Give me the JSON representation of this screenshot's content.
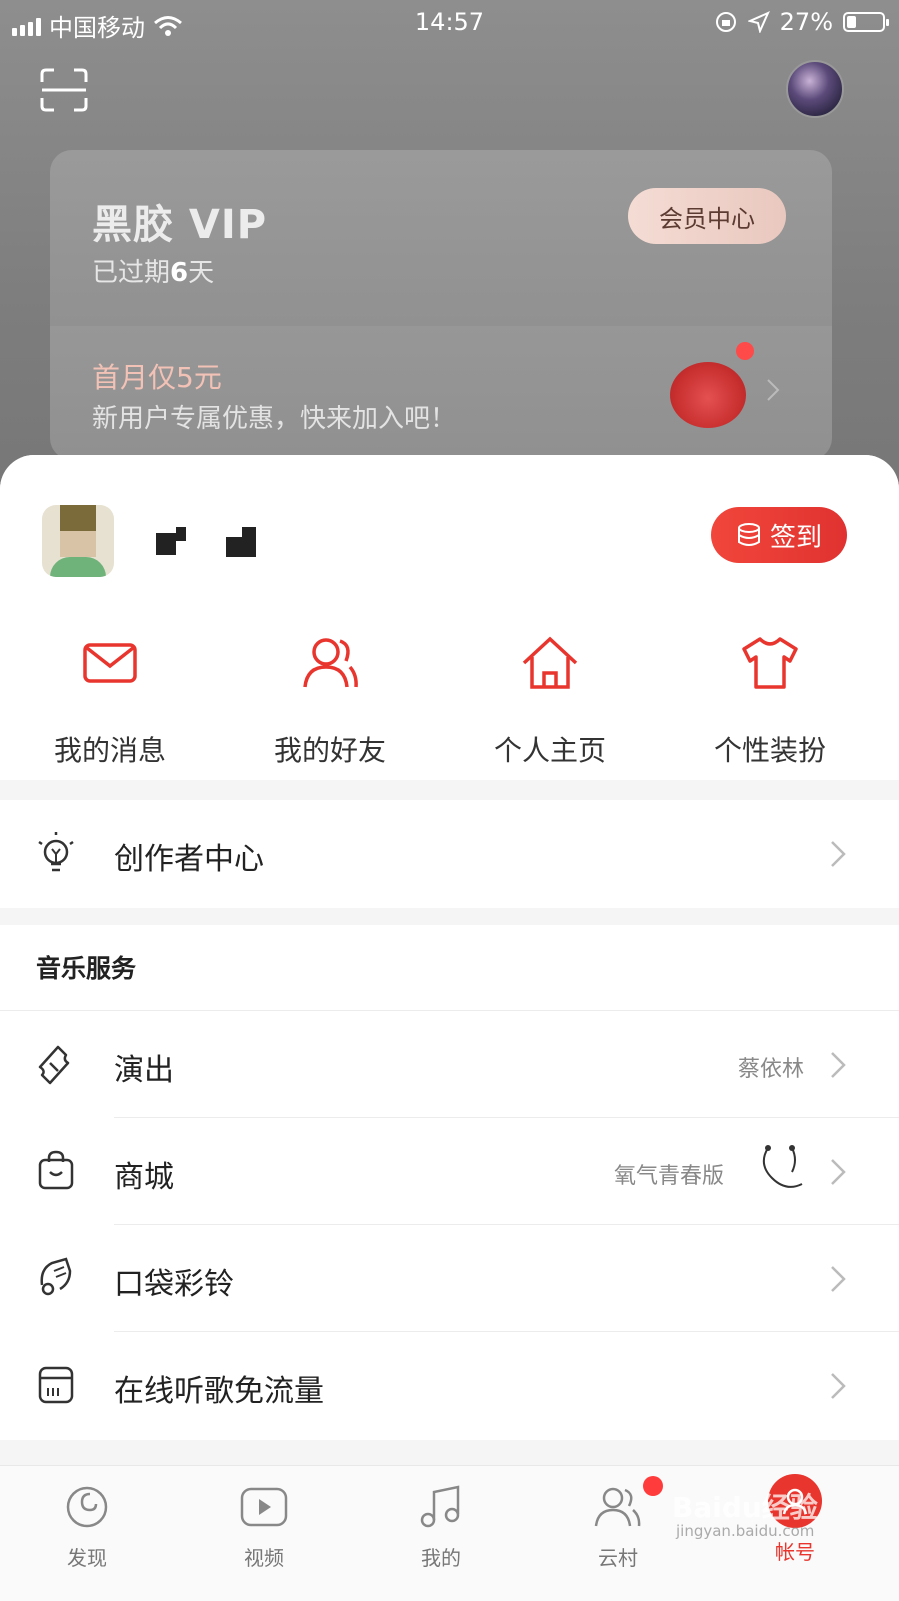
{
  "status_bar": {
    "carrier": "中国移动",
    "time": "14:57",
    "battery": "27%",
    "battery_level": 0.27
  },
  "vip": {
    "logo": "黑胶 VIP",
    "expiry_prefix": "已过期",
    "expiry_days": "6",
    "expiry_suffix": "天",
    "center_button": "会员中心",
    "promo_title": "首月仅5元",
    "promo_subtitle": "新用户专属优惠，快来加入吧！"
  },
  "profile": {
    "checkin_label": "签到"
  },
  "quick_actions": [
    {
      "label": "我的消息",
      "icon": "mail-icon"
    },
    {
      "label": "我的好友",
      "icon": "friends-icon"
    },
    {
      "label": "个人主页",
      "icon": "home-icon"
    },
    {
      "label": "个性装扮",
      "icon": "shirt-icon"
    }
  ],
  "creator_center": {
    "label": "创作者中心",
    "icon": "lightbulb-icon"
  },
  "music_services": {
    "heading": "音乐服务",
    "items": [
      {
        "label": "演出",
        "right": "蔡依林",
        "icon": "ticket-icon"
      },
      {
        "label": "商城",
        "right": "氧气青春版",
        "icon": "bag-icon"
      },
      {
        "label": "口袋彩铃",
        "right": "",
        "icon": "ringtone-icon"
      },
      {
        "label": "在线听歌免流量",
        "right": "",
        "icon": "data-card-icon"
      }
    ]
  },
  "tabs": [
    {
      "label": "发现",
      "icon": "discover-icon"
    },
    {
      "label": "视频",
      "icon": "video-icon"
    },
    {
      "label": "我的",
      "icon": "music-note-icon"
    },
    {
      "label": "云村",
      "icon": "community-icon"
    },
    {
      "label": "帐号",
      "icon": "account-icon"
    }
  ],
  "watermark": {
    "text": "Baidu经验",
    "sub": "jingyan.baidu.com"
  },
  "colors": {
    "accent": "#e8352d",
    "vip_button": "#f1d6cd"
  }
}
